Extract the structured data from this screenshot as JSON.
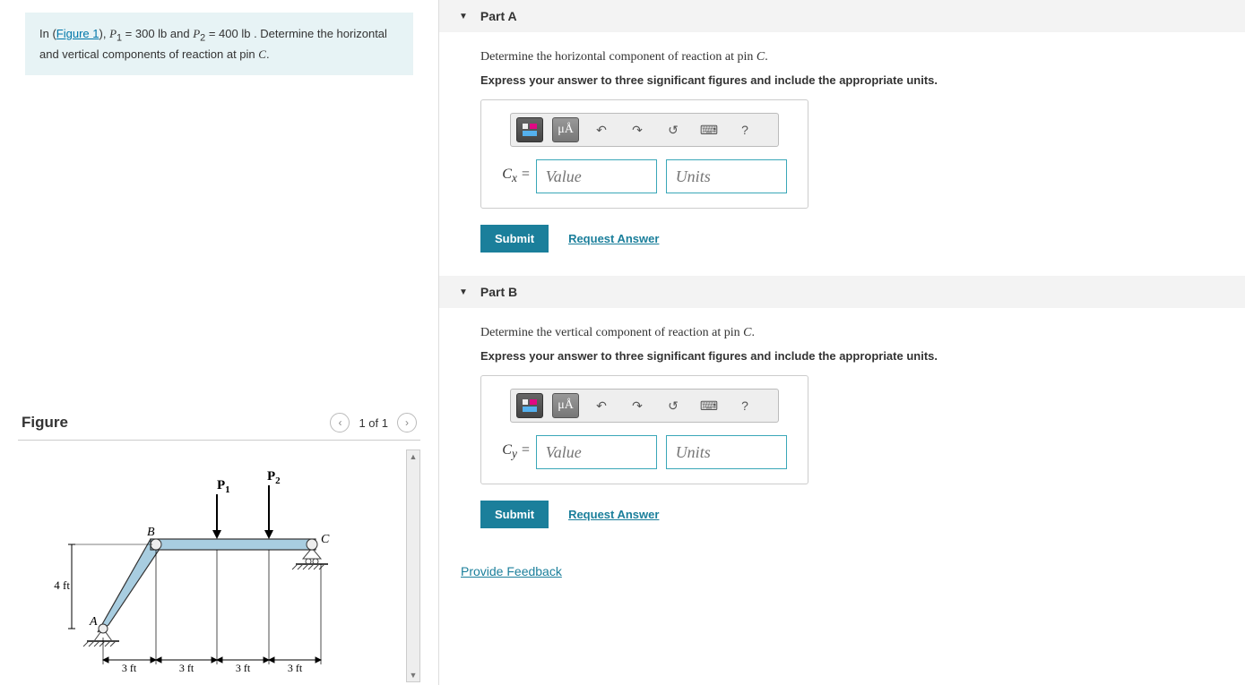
{
  "problem": {
    "prefix": "In (",
    "figure_link": "Figure 1",
    "after_link": "), ",
    "p1_sym": "P",
    "p1_sub": "1",
    "eq1": " = 300 lb",
    "and": " and ",
    "p2_sym": "P",
    "p2_sub": "2",
    "eq2": " = 400 lb",
    "rest": " . Determine the horizontal and vertical components of reaction at pin ",
    "pin": "C",
    "period": "."
  },
  "figure": {
    "title": "Figure",
    "page": "1 of 1",
    "labels": {
      "P1": "P",
      "P1s": "1",
      "P2": "P",
      "P2s": "2",
      "A": "A",
      "B": "B",
      "C": "C",
      "h": "4 ft",
      "d": "3 ft"
    }
  },
  "parts": {
    "a": {
      "title": "Part A",
      "q": "Determine the horizontal component of reaction at pin ",
      "pin": "C",
      "qend": ".",
      "inst": "Express your answer to three significant figures and include the appropriate units.",
      "label_sym": "C",
      "label_sub": "x",
      "eq": " = ",
      "val_ph": "Value",
      "unit_ph": "Units",
      "submit": "Submit",
      "req": "Request Answer"
    },
    "b": {
      "title": "Part B",
      "q": "Determine the vertical component of reaction at pin ",
      "pin": "C",
      "qend": ".",
      "inst": "Express your answer to three significant figures and include the appropriate units.",
      "label_sym": "C",
      "label_sub": "y",
      "eq": " = ",
      "val_ph": "Value",
      "unit_ph": "Units",
      "submit": "Submit",
      "req": "Request Answer"
    }
  },
  "toolbar": {
    "units_glyph": "μÅ",
    "undo": "↶",
    "redo": "↷",
    "reset": "↺",
    "keyboard": "⌨",
    "help": "?"
  },
  "feedback": "Provide Feedback"
}
